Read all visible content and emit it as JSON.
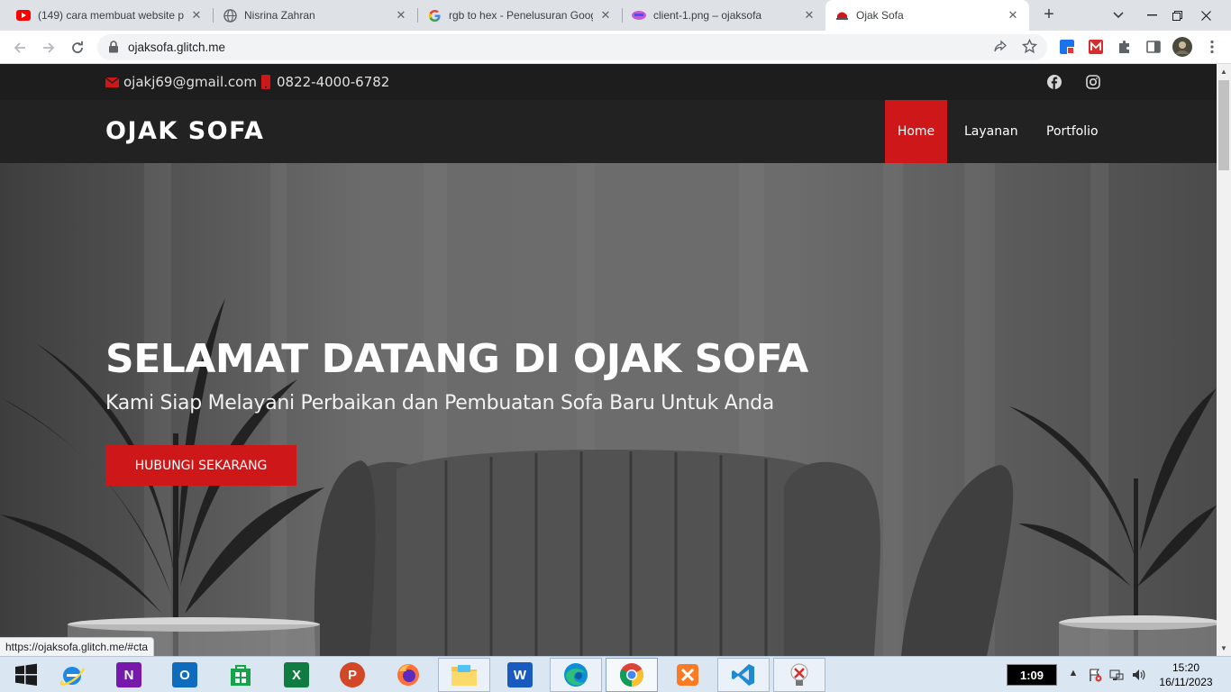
{
  "browser": {
    "tabs": [
      {
        "title": "(149) cara membuat website p",
        "icon": "youtube-icon"
      },
      {
        "title": "Nisrina Zahran",
        "icon": "globe-icon"
      },
      {
        "title": "rgb to hex - Penelusuran Goog",
        "icon": "google-icon"
      },
      {
        "title": "client-1.png – ojaksofa",
        "icon": "glitch-icon"
      },
      {
        "title": "Ojak Sofa",
        "icon": "sofa-favicon-icon"
      }
    ],
    "active_tab": 4,
    "url": "ojaksofa.glitch.me",
    "status_url": "https://ojaksofa.glitch.me/#cta"
  },
  "site": {
    "email": "ojakj69@gmail.com",
    "phone": "0822-4000-6782",
    "logo": "OJAK SOFA",
    "nav": [
      {
        "label": "Home",
        "active": true
      },
      {
        "label": "Layanan",
        "active": false
      },
      {
        "label": "Portfolio",
        "active": false
      }
    ],
    "hero": {
      "title": "SELAMAT DATANG DI OJAK SOFA",
      "subtitle": "Kami Siap Melayani Perbaikan dan Pembuatan Sofa Baru Untuk Anda",
      "cta": "HUBUNGI SEKARANG"
    },
    "colors": {
      "accent": "#cd1718",
      "topbar": "#1d1d1d",
      "header": "#222222"
    }
  },
  "taskbar": {
    "apps": [
      "start-icon",
      "internet-explorer-icon",
      "onenote-icon",
      "outlook-icon",
      "store-icon",
      "excel-icon",
      "powerpoint-icon",
      "firefox-icon",
      "file-explorer-icon",
      "word-icon",
      "edge-icon",
      "chrome-icon",
      "xampp-icon",
      "vscode-icon",
      "snipping-tool-icon"
    ],
    "timer": "1:09",
    "time": "15:20",
    "date": "16/11/2023"
  }
}
